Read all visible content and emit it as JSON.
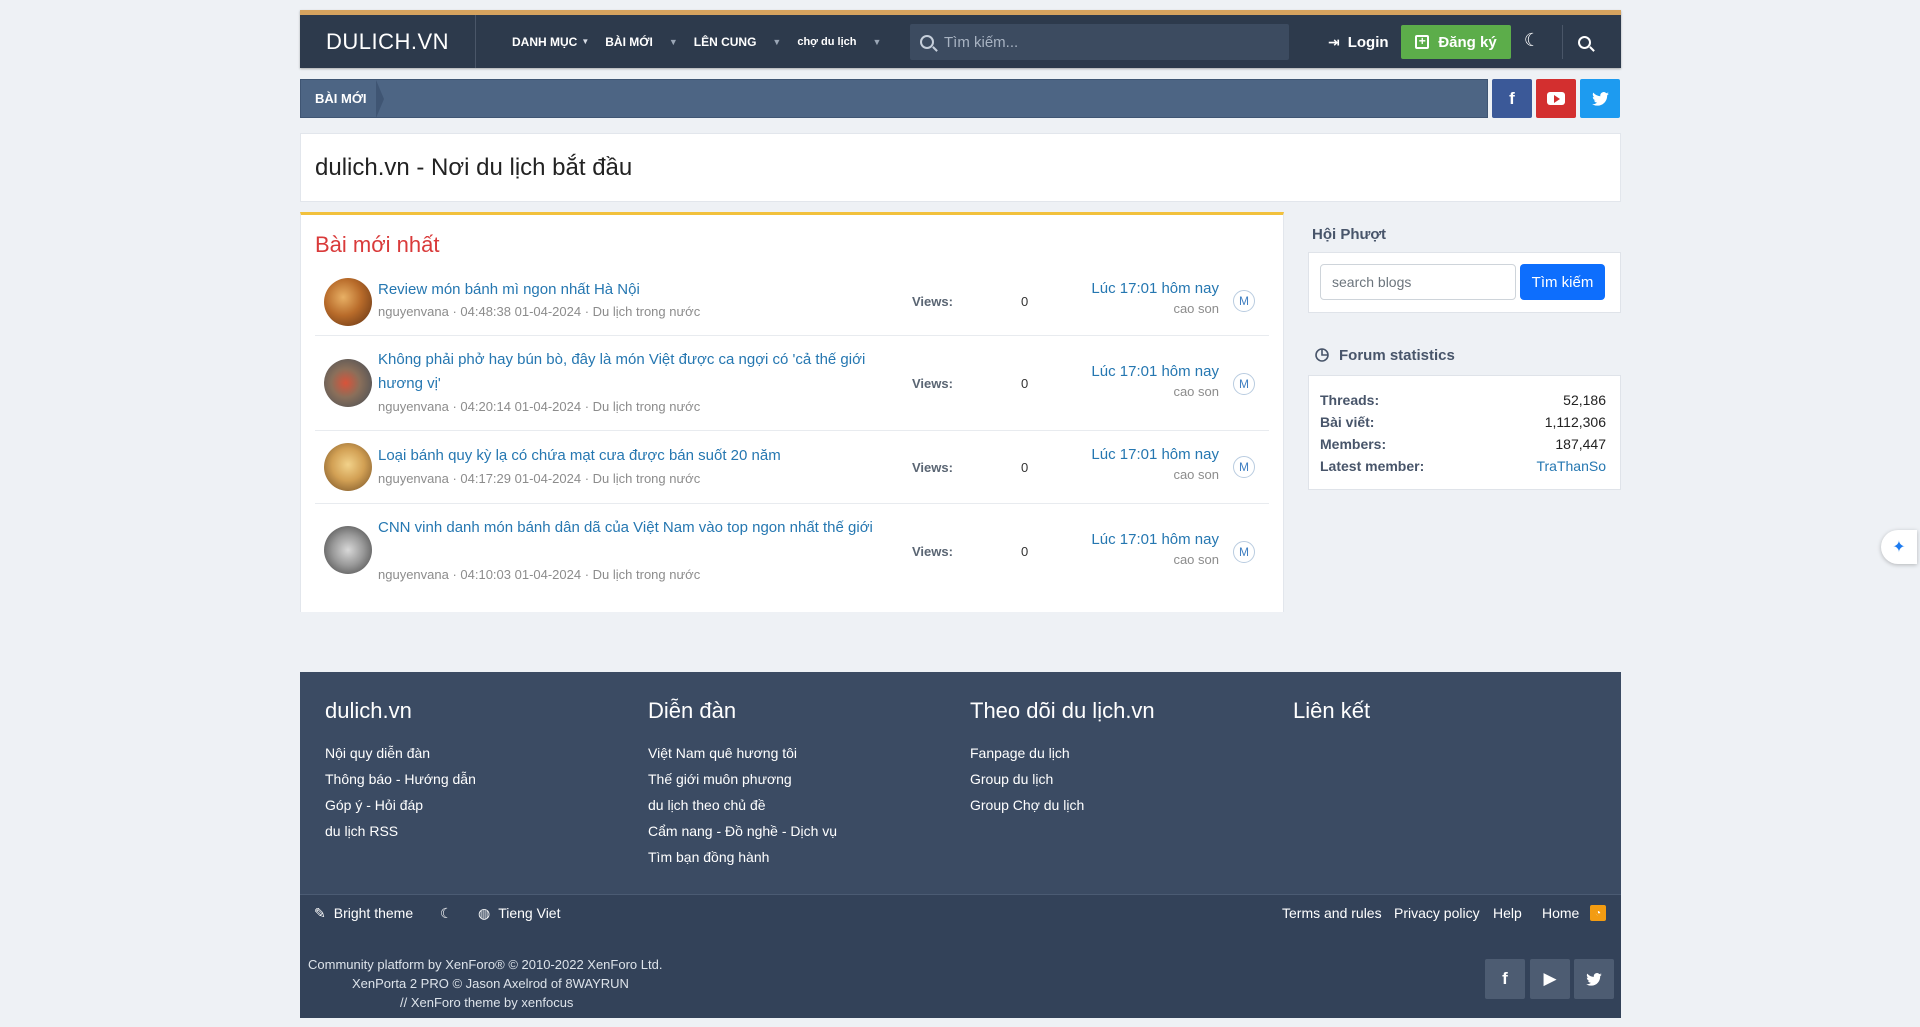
{
  "header": {
    "logo": "DULICH.VN",
    "nav": [
      {
        "label": "DANH MỤC"
      },
      {
        "label": "BÀI MỚI"
      },
      {
        "label": "LÊN CUNG"
      },
      {
        "label": "chợ du lịch"
      }
    ],
    "search_placeholder": "Tìm kiếm...",
    "login_label": "Login",
    "register_label": "Đăng ký"
  },
  "breadcrumb": {
    "item": "BÀI MỚI"
  },
  "page_title": "dulich.vn - Nơi du lịch bắt đầu",
  "latest": {
    "heading": "Bài mới nhất",
    "views_label": "Views:",
    "threads": [
      {
        "title": "Review món bánh mì ngon nhất Hà Nội",
        "meta": "nguyenvana · 04:48:38 01-04-2024 · Du lịch trong nước",
        "views": "0",
        "last_time": "Lúc 17:01 hôm nay",
        "last_user": "cao son",
        "badge": "M"
      },
      {
        "title": "Không phải phở hay bún bò, đây là món Việt được ca ngợi có 'cả thế giới hương vị'",
        "meta": "nguyenvana · 04:20:14 01-04-2024 · Du lịch trong nước",
        "views": "0",
        "last_time": "Lúc 17:01 hôm nay",
        "last_user": "cao son",
        "badge": "M"
      },
      {
        "title": "Loại bánh quy kỳ lạ có chứa mạt cưa được bán suốt 20 năm",
        "meta": "nguyenvana · 04:17:29 01-04-2024 · Du lịch trong nước",
        "views": "0",
        "last_time": "Lúc 17:01 hôm nay",
        "last_user": "cao son",
        "badge": "M"
      },
      {
        "title": "CNN vinh danh món bánh dân dã của Việt Nam vào top ngon nhất thế giới",
        "meta": "nguyenvana · 04:10:03 01-04-2024 · Du lịch trong nước",
        "views": "0",
        "last_time": "Lúc 17:01 hôm nay",
        "last_user": "cao son",
        "badge": "M"
      }
    ]
  },
  "sidebar": {
    "blog_heading": "Hội Phượt",
    "blog_search_placeholder": "search blogs",
    "blog_search_button": "Tìm kiếm",
    "stats_heading": "Forum statistics",
    "stats": [
      {
        "label": "Threads:",
        "value": "52,186"
      },
      {
        "label": "Bài viết:",
        "value": "1,112,306"
      },
      {
        "label": "Members:",
        "value": "187,447"
      },
      {
        "label": "Latest member:",
        "value": "TraThanSo"
      }
    ]
  },
  "footer": {
    "columns": [
      {
        "title": "dulich.vn",
        "links": [
          "Nội quy diễn đàn",
          "Thông báo - Hướng dẫn",
          "Góp ý - Hỏi đáp",
          "du lịch RSS"
        ]
      },
      {
        "title": "Diễn đàn",
        "links": [
          "Việt Nam quê hương tôi",
          "Thế giới muôn phương",
          "du lịch theo chủ đề",
          "Cẩm nang - Đồ nghề - Dịch vụ",
          "Tìm bạn đồng hành"
        ]
      },
      {
        "title": "Theo dõi du lịch.vn",
        "links": [
          "Fanpage du lịch",
          "Group du lịch",
          "Group Chợ du lịch"
        ]
      },
      {
        "title": "Liên kết",
        "links": []
      }
    ],
    "bright_theme": "Bright theme",
    "language": "Tieng Viet",
    "terms": "Terms and rules",
    "privacy": "Privacy policy",
    "help": "Help",
    "home": "Home",
    "copyright_1": "Community platform by XenForo® © 2010-2022 XenForo Ltd.",
    "copyright_2": "XenPorta 2 PRO © Jason Axelrod of 8WAYRUN",
    "copyright_3": "//   XenForo theme by xenfocus"
  },
  "colors": {
    "accent": "#2d3a4c",
    "register": "#5cad4a",
    "heading_red": "#d93a3a",
    "link": "#2577b1"
  }
}
